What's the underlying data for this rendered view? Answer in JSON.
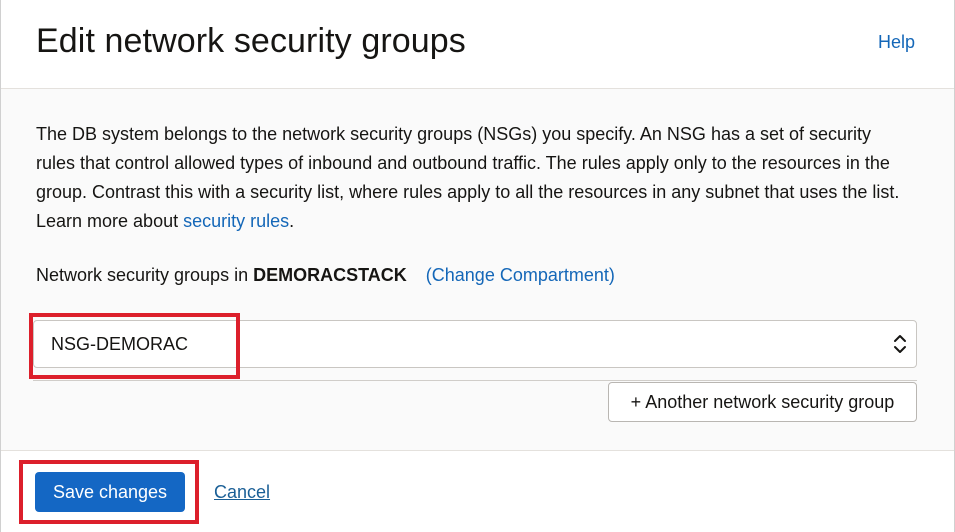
{
  "dialog": {
    "title": "Edit network security groups",
    "help_label": "Help"
  },
  "body": {
    "description_text": "The DB system belongs to the network security groups (NSGs) you specify. An NSG has a set of security rules that control allowed types of inbound and outbound traffic. The rules apply only to the resources in the group. Contrast this with a security list, where rules apply to all the resources in any subnet that uses the list. Learn more about ",
    "description_link": "security rules",
    "description_end": ".",
    "compartment_prefix": "Network security groups in ",
    "compartment_name": "DEMORACSTACK",
    "change_compartment_label": "(Change Compartment)",
    "nsg_select_value": "NSG-DEMORAC",
    "another_nsg_label": "+ Another network security group"
  },
  "footer": {
    "save_label": "Save changes",
    "cancel_label": "Cancel"
  },
  "colors": {
    "link": "#1467b8",
    "primary_button": "#1467c4",
    "highlight": "#dc1f2b"
  }
}
